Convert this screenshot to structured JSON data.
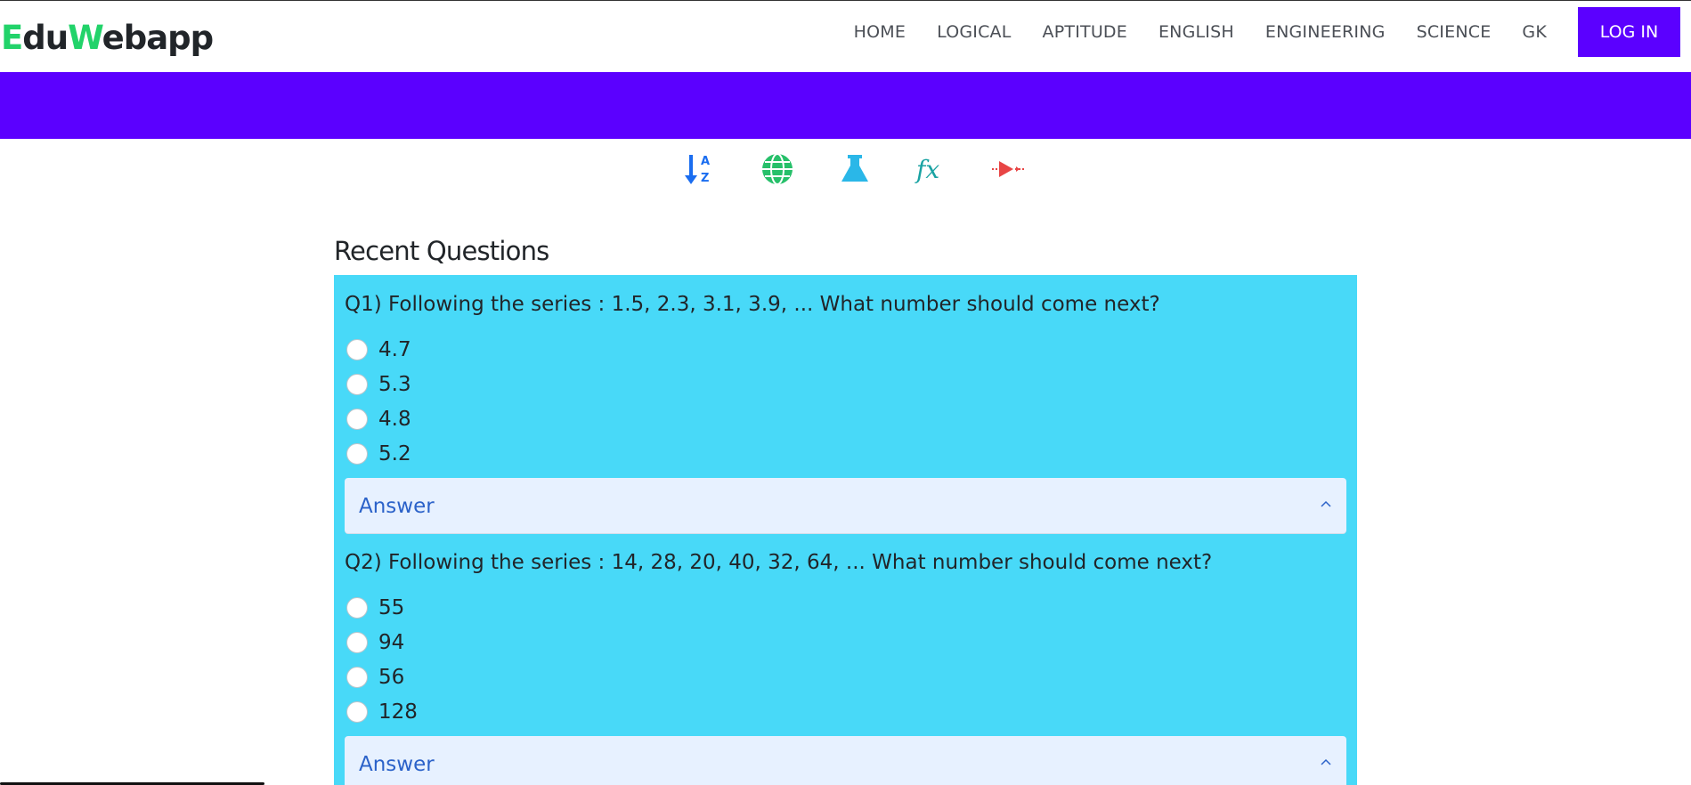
{
  "brand": {
    "letter_e": "E",
    "part_du": "du",
    "letter_w": "W",
    "part_ebapp": "ebapp"
  },
  "nav": {
    "items": [
      "HOME",
      "LOGICAL",
      "APTITUDE",
      "ENGLISH",
      "ENGINEERING",
      "SCIENCE",
      "GK"
    ],
    "login": "LOG IN"
  },
  "category_icons": [
    "sort-alpha-icon",
    "globe-icon",
    "flask-icon",
    "function-icon",
    "diode-icon"
  ],
  "section": {
    "title": "Recent Questions"
  },
  "questions": [
    {
      "text": "Q1) Following the series : 1.5, 2.3, 3.1, 3.9, ... What number should come next?",
      "options": [
        "4.7",
        "5.3",
        "4.8",
        "5.2"
      ],
      "answer_label": "Answer"
    },
    {
      "text": "Q2) Following the series : 14, 28, 20, 40, 32, 64, ... What number should come next?",
      "options": [
        "55",
        "94",
        "56",
        "128"
      ],
      "answer_label": "Answer"
    }
  ],
  "colors": {
    "brand_accent": "#22d36a",
    "primary_purple": "#5b00ff",
    "question_bg": "#48d9f8",
    "answer_bg": "#e7f1ff",
    "answer_text": "#2b62c9"
  }
}
